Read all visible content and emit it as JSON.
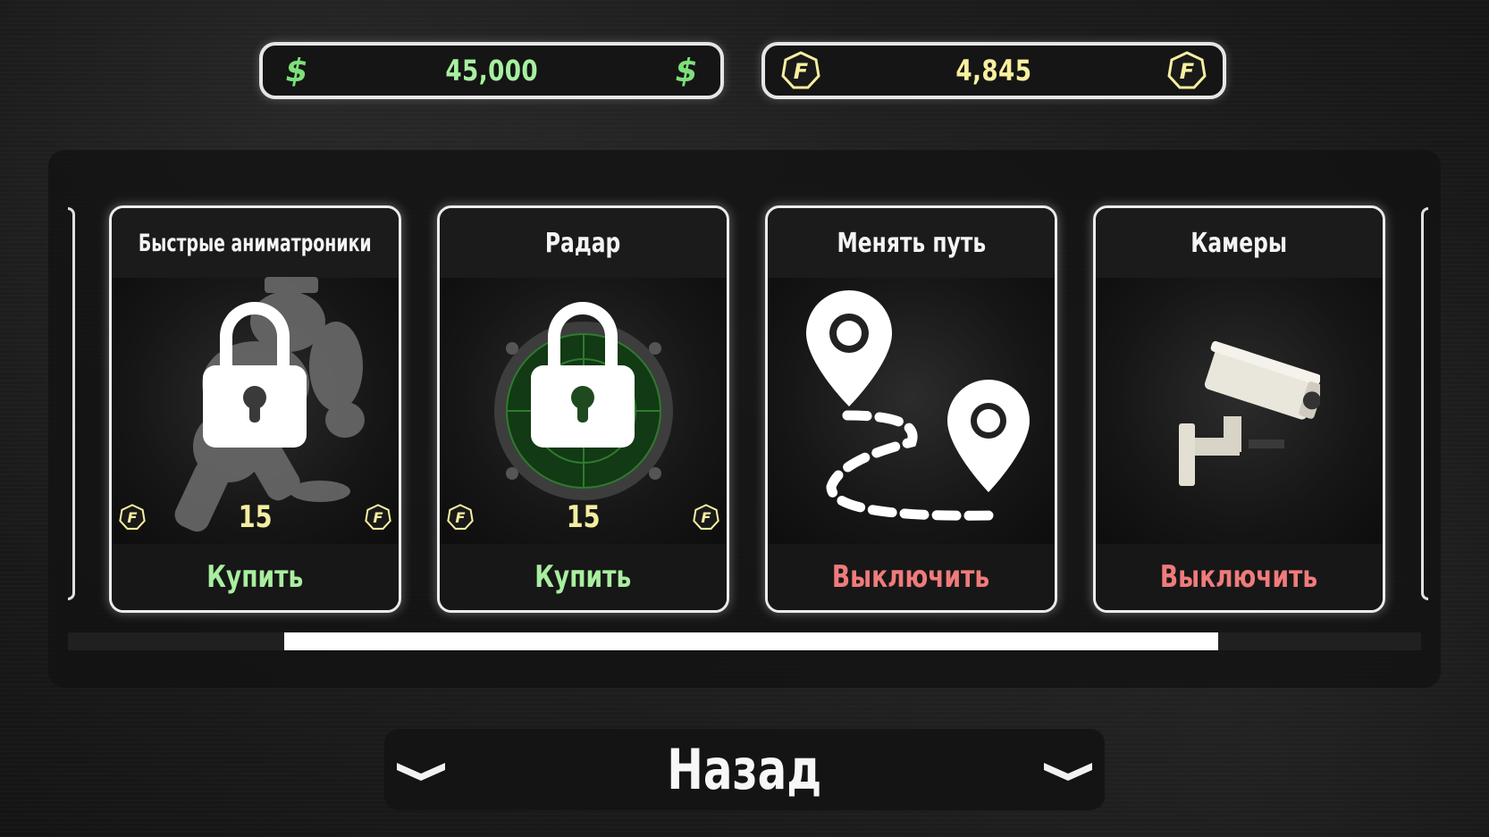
{
  "currencies": {
    "money": {
      "value": "45,000",
      "symbol": "$"
    },
    "faz": {
      "value": "4,845",
      "symbol": "F"
    }
  },
  "cards": [
    {
      "title": "Быстрые аниматроники",
      "price": "15",
      "action": "Купить",
      "locked": true,
      "art": "fast-animatronic-silhouette"
    },
    {
      "title": "Радар",
      "price": "15",
      "action": "Купить",
      "locked": true,
      "art": "radar"
    },
    {
      "title": "Менять путь",
      "action": "Выключить",
      "locked": false,
      "art": "route-pins"
    },
    {
      "title": "Камеры",
      "action": "Выключить",
      "locked": false,
      "art": "security-camera"
    }
  ],
  "scroll": {
    "position_fraction": 0.16,
    "visible_fraction": 0.69
  },
  "back_button": {
    "label": "Назад"
  },
  "colors": {
    "money": "#a7f0a0",
    "faz": "#f7efa0",
    "buy": "#a8ef9f",
    "turn_off": "#ef7b7b"
  }
}
